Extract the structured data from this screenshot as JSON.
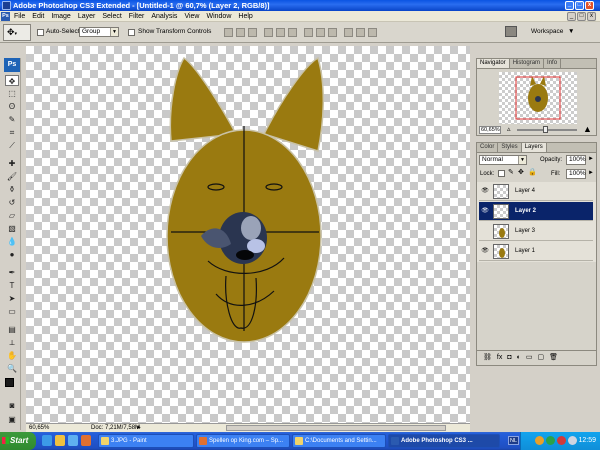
{
  "window": {
    "title": "Adobe Photoshop CS3 Extended - [Untitled-1 @ 60,7% (Layer 2, RGB/8)]",
    "mdi_controls": [
      "_",
      "□",
      "x"
    ]
  },
  "menu": [
    "File",
    "Edit",
    "Image",
    "Layer",
    "Select",
    "Filter",
    "Analysis",
    "View",
    "Window",
    "Help"
  ],
  "options_bar": {
    "auto_select_label": "Auto-Select:",
    "auto_select_value": "Group",
    "show_transform_label": "Show Transform Controls",
    "workspace_label": "Workspace"
  },
  "toolbox": {
    "logo": "Ps",
    "tools": [
      "move",
      "marquee",
      "lasso",
      "quick-select",
      "crop",
      "slice",
      "healing",
      "brush",
      "stamp",
      "history-brush",
      "eraser",
      "gradient",
      "blur",
      "dodge",
      "pen",
      "type",
      "path-select",
      "shape",
      "notes",
      "eyedropper",
      "hand",
      "zoom"
    ],
    "foreground_color": "#1a1a1a",
    "background_color": "#5a3a2a"
  },
  "canvas": {
    "zoom": "60,65%",
    "doc_info": "Doc: 7,21M/7,58M",
    "fur_color": "#9a7a10",
    "nose_color": "#2a3550"
  },
  "navigator": {
    "tabs": [
      "Navigator",
      "Histogram",
      "Info"
    ],
    "zoom": "60,65%"
  },
  "layers_panel": {
    "tabs": [
      "Color",
      "Styles",
      "Layers"
    ],
    "blend_mode": "Normal",
    "opacity_label": "Opacity:",
    "opacity_value": "100%",
    "lock_label": "Lock:",
    "fill_label": "Fill:",
    "fill_value": "100%",
    "layers": [
      {
        "name": "Layer 4",
        "visible": true,
        "selected": false
      },
      {
        "name": "Layer 2",
        "visible": true,
        "selected": true
      },
      {
        "name": "Layer 3",
        "visible": false,
        "selected": false
      },
      {
        "name": "Layer 1",
        "visible": true,
        "selected": false
      }
    ]
  },
  "taskbar": {
    "start": "Start",
    "buttons": [
      {
        "label": "3.JPG - Paint",
        "active": false
      },
      {
        "label": "Spellen op King.com – Sp...",
        "active": false
      },
      {
        "label": "C:\\Documents and Settin...",
        "active": false
      },
      {
        "label": "Adobe Photoshop CS3 ...",
        "active": true
      }
    ],
    "language": "NL",
    "clock": "12:59"
  }
}
